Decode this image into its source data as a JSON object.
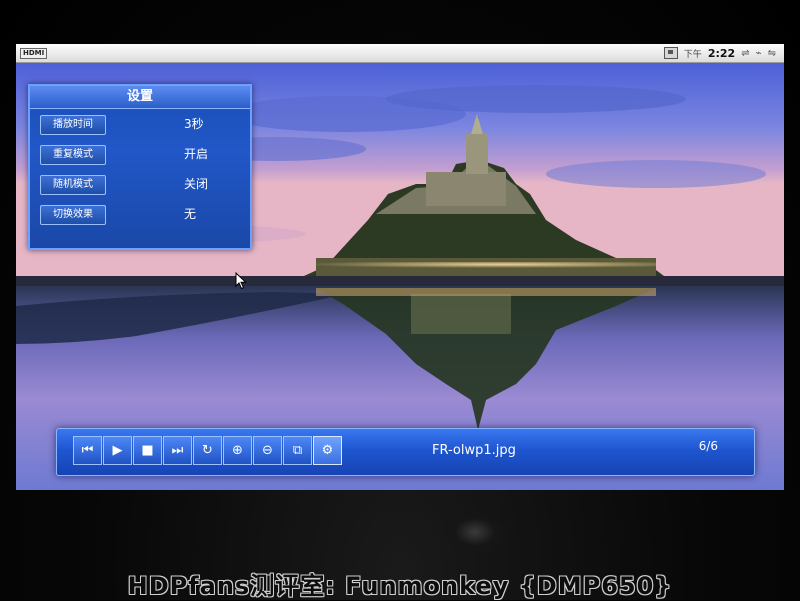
{
  "status_bar": {
    "logo": "HDMI",
    "ampm": "下午",
    "time": "2:22",
    "icons": [
      "network-icon",
      "usb-icon",
      "sd-card-icon"
    ]
  },
  "settings_panel": {
    "title": "设置",
    "rows": [
      {
        "label": "播放时间",
        "value": "3秒"
      },
      {
        "label": "重复模式",
        "value": "开启"
      },
      {
        "label": "随机模式",
        "value": "关闭"
      },
      {
        "label": "切换效果",
        "value": "无"
      }
    ]
  },
  "toolbar": {
    "buttons": [
      {
        "icon": "previous-icon",
        "glyph": "⏮"
      },
      {
        "icon": "play-icon",
        "glyph": "▶"
      },
      {
        "icon": "stop-icon",
        "glyph": "■"
      },
      {
        "icon": "next-icon",
        "glyph": "⏭"
      },
      {
        "icon": "rotate-icon",
        "glyph": "↻"
      },
      {
        "icon": "zoom-in-icon",
        "glyph": "⊕"
      },
      {
        "icon": "zoom-out-icon",
        "glyph": "⊖"
      },
      {
        "icon": "resize-icon",
        "glyph": "⧉"
      },
      {
        "icon": "settings-gear-icon",
        "glyph": "⚙"
      }
    ],
    "filename": "FR-olwp1.jpg",
    "counter": "6/6"
  },
  "watermark": "HDPfans测评室: Funmonkey {DMP650}",
  "colors": {
    "panel_blue": "#2157c7",
    "toolbar_blue": "#1e56d0",
    "sky_purple": "#8d88d8"
  }
}
